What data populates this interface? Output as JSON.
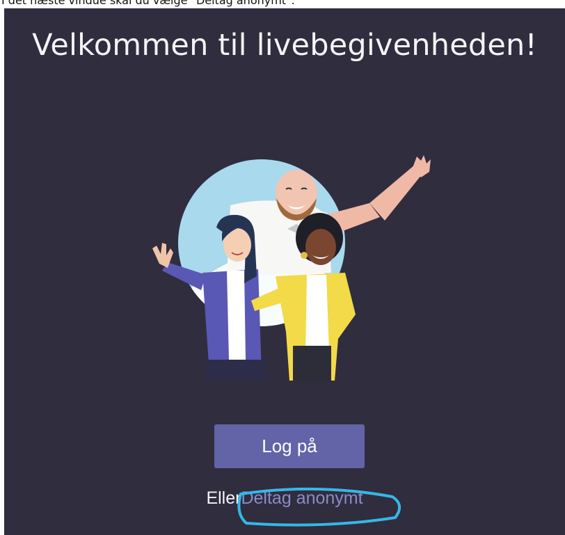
{
  "instruction_text": "I det næste vindue skal du vælge \"Deltag anonymt\".",
  "welcome": {
    "title": "Velkommen til livebegivenheden!"
  },
  "actions": {
    "login_label": "Log på",
    "alt_prefix": "Eller",
    "anonymous_label": "Deltag anonymt"
  },
  "colors": {
    "background": "#302d3f",
    "button": "#6264a7",
    "link": "#8b8cc7",
    "highlight": "#36b8e6",
    "circle": "#a9d9ec"
  }
}
